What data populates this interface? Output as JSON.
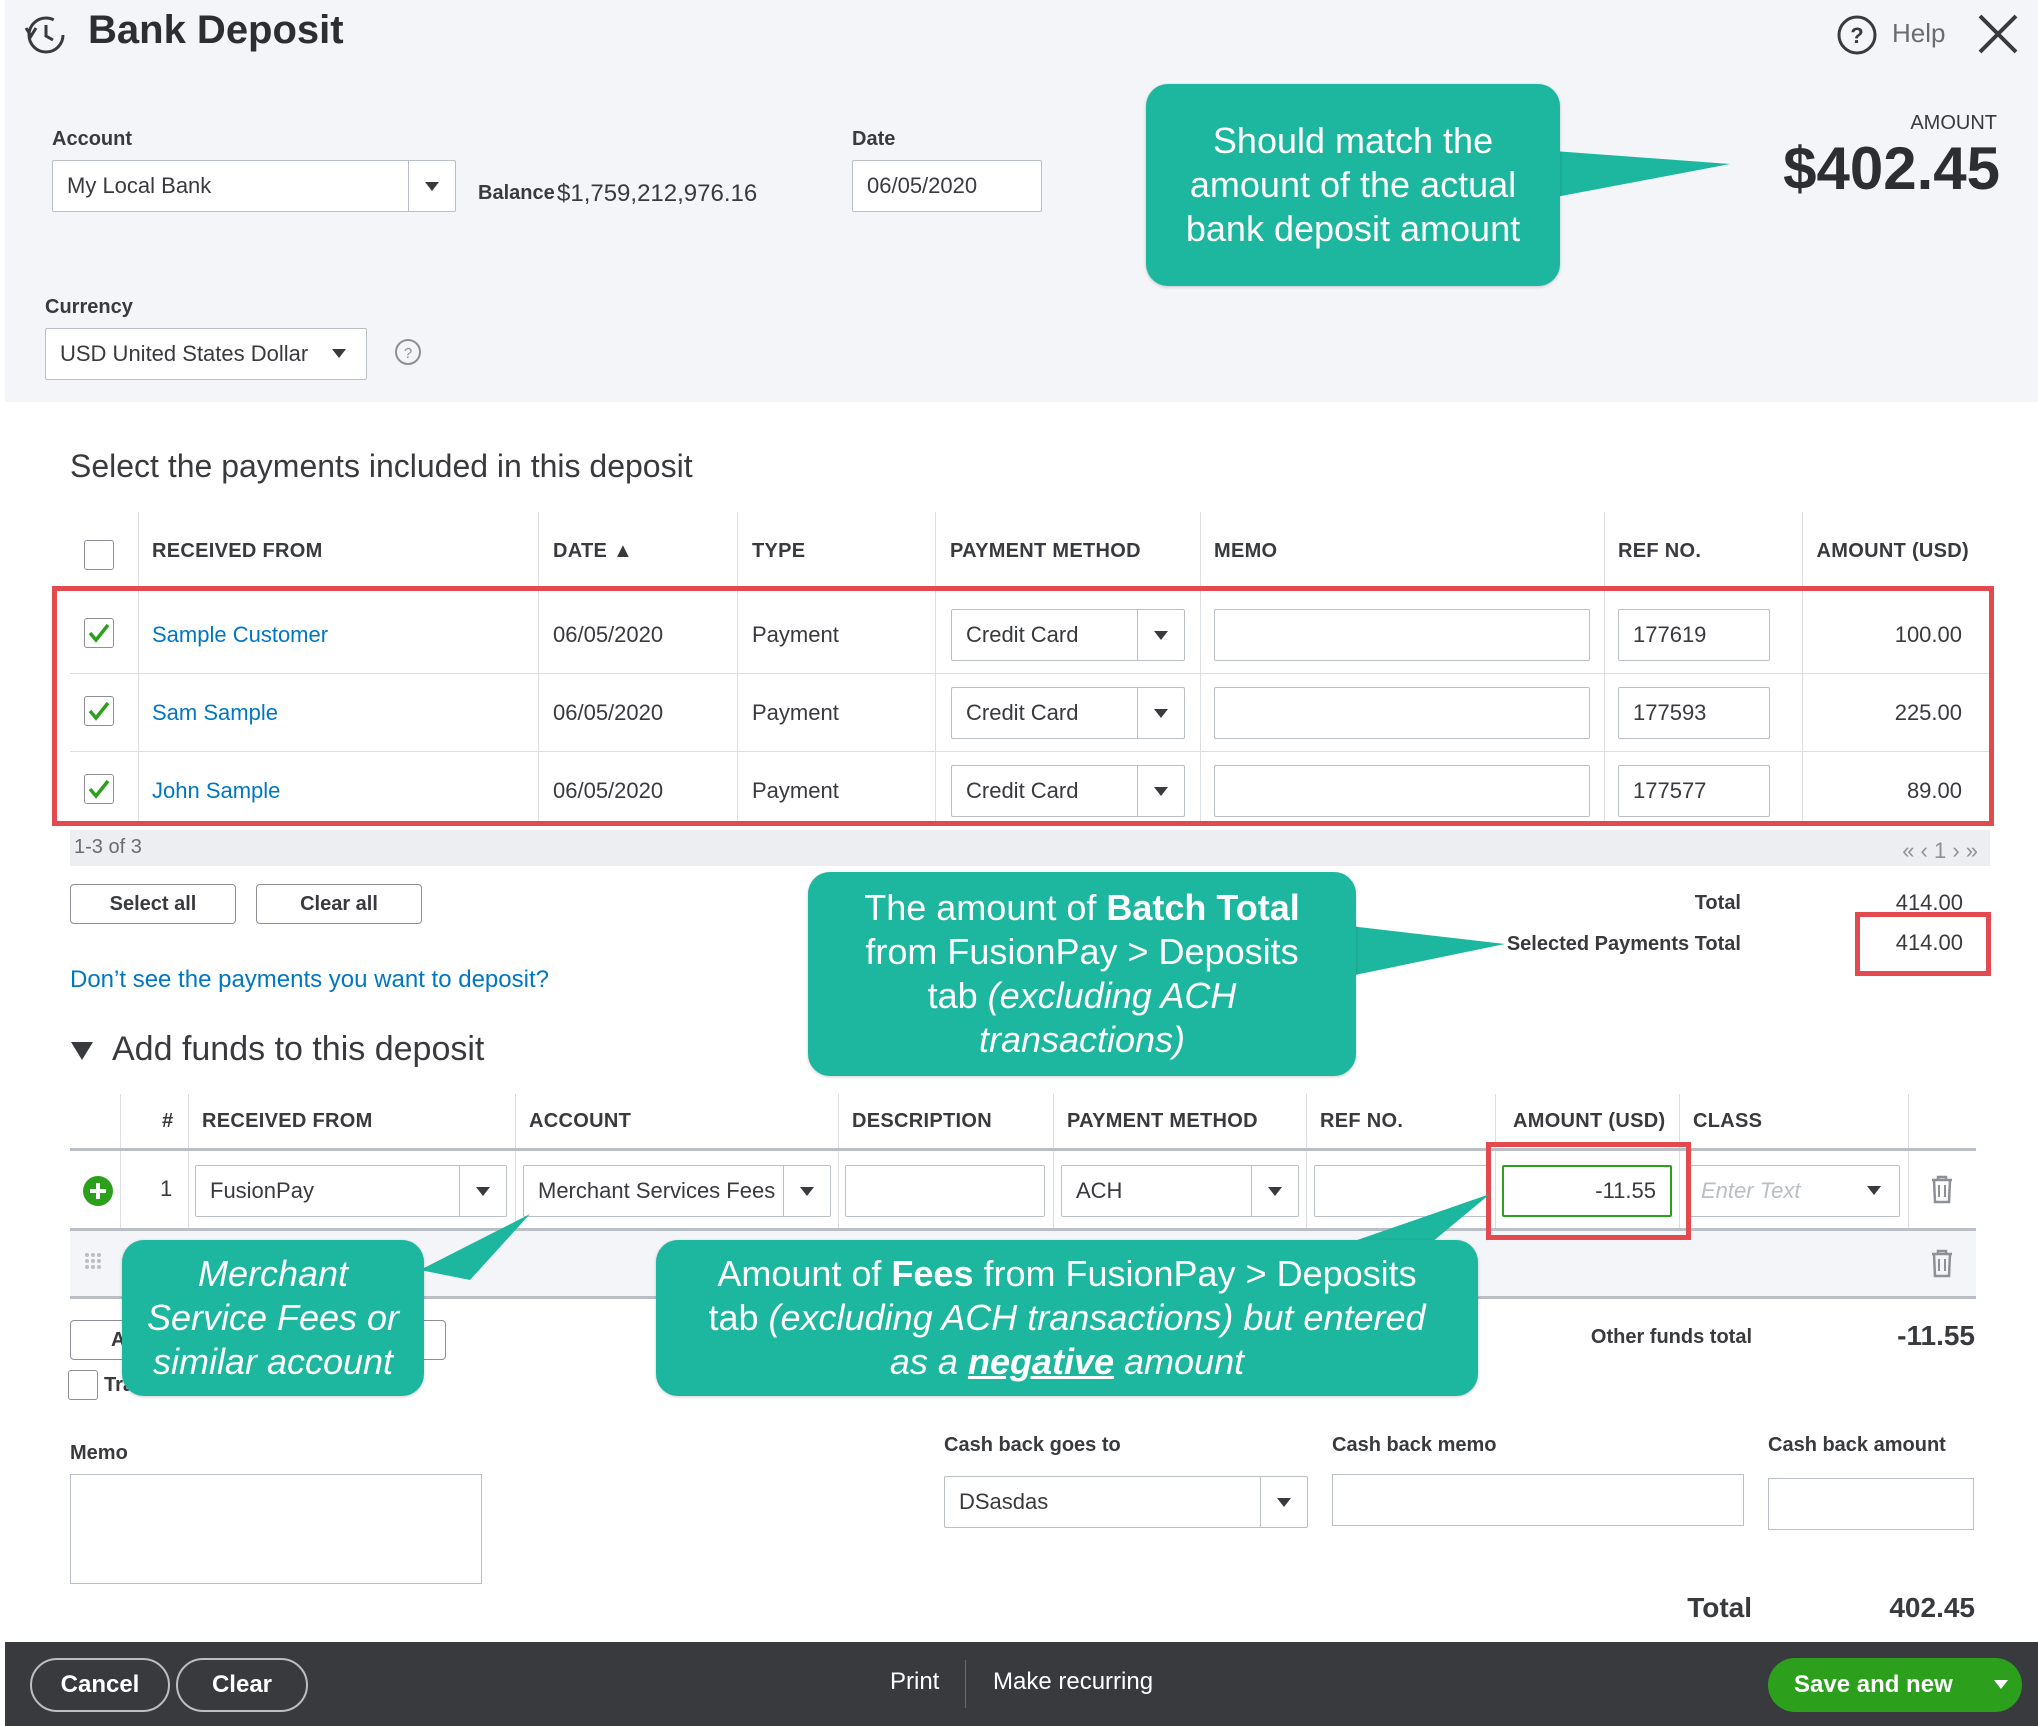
{
  "header": {
    "title": "Bank Deposit",
    "help_label": "Help",
    "account_label": "Account",
    "account_value": "My Local Bank",
    "balance_label": "Balance",
    "balance_value": "$1,759,212,976.16",
    "date_label": "Date",
    "date_value": "06/05/2020",
    "currency_label": "Currency",
    "currency_value": "USD United States Dollar",
    "amount_label": "AMOUNT",
    "amount_value": "$402.45"
  },
  "payments": {
    "heading": "Select the payments included in this deposit",
    "columns": [
      "RECEIVED FROM",
      "DATE ▲",
      "TYPE",
      "PAYMENT METHOD",
      "MEMO",
      "REF NO.",
      "AMOUNT (USD)"
    ],
    "rows": [
      {
        "received_from": "Sample Customer",
        "date": "06/05/2020",
        "type": "Payment",
        "method": "Credit Card",
        "memo": "",
        "ref": "177619",
        "amount": "100.00"
      },
      {
        "received_from": "Sam Sample",
        "date": "06/05/2020",
        "type": "Payment",
        "method": "Credit Card",
        "memo": "",
        "ref": "177593",
        "amount": "225.00"
      },
      {
        "received_from": "John Sample",
        "date": "06/05/2020",
        "type": "Payment",
        "method": "Credit Card",
        "memo": "",
        "ref": "177577",
        "amount": "89.00"
      }
    ],
    "range_text": "1-3 of 3",
    "pager": "« ‹ 1 › »",
    "select_all": "Select all",
    "clear_all": "Clear all",
    "total_label": "Total",
    "total_value": "414.00",
    "selected_total_label": "Selected Payments Total",
    "selected_total_value": "414.00",
    "missing_link": "Don’t see the payments you want to deposit?"
  },
  "funds": {
    "heading": "Add funds to this deposit",
    "columns": [
      "#",
      "RECEIVED FROM",
      "ACCOUNT",
      "DESCRIPTION",
      "PAYMENT METHOD",
      "REF NO.",
      "AMOUNT (USD)",
      "CLASS"
    ],
    "row": {
      "num": "1",
      "received_from": "FusionPay",
      "account": "Merchant Services Fees",
      "description": "",
      "method": "ACH",
      "ref": "",
      "amount": "-11.55",
      "class_placeholder": "Enter Text"
    },
    "add_lines_fragment": "A",
    "track_fragment": "Tra",
    "other_funds_label": "Other funds total",
    "other_funds_value": "-11.55"
  },
  "bottom": {
    "memo_label": "Memo",
    "cash_back_to_label": "Cash back goes to",
    "cash_back_to_value": "DSasdas",
    "cash_back_memo_label": "Cash back memo",
    "cash_back_amount_label": "Cash back amount",
    "total_label": "Total",
    "total_value": "402.45"
  },
  "footer": {
    "cancel": "Cancel",
    "clear": "Clear",
    "print": "Print",
    "make_recurring": "Make recurring",
    "save_new": "Save and new"
  },
  "callouts": {
    "amount": [
      "Should match the",
      "amount of the actual",
      "bank deposit amount"
    ],
    "batch": {
      "line1_pre": "The amount of ",
      "line1_bold": "Batch Total",
      "line2": "from FusionPay > Deposits",
      "line3_pre": "tab ",
      "line3_italic": "(excluding ACH",
      "line4_italic": "transactions)"
    },
    "merchant": [
      "Merchant",
      "Service Fees or",
      "similar account"
    ],
    "fees": {
      "line1_pre": "Amount of ",
      "line1_bold": "Fees",
      "line1_post": " from FusionPay > Deposits",
      "line2_pre": "tab ",
      "line2_italic": "(excluding ACH transactions) but entered",
      "line3_pre": "as a ",
      "line3_bold": "negative",
      "line3_post": " amount"
    }
  },
  "colors": {
    "accent_green": "#2ca01c",
    "callout_teal": "#1db69f",
    "highlight_red": "#e34a4f",
    "link_blue": "#0077c5"
  },
  "icons": [
    "recent-history-icon",
    "help-circle-icon",
    "close-icon",
    "check-icon",
    "add-circle-icon",
    "trash-icon",
    "drag-handle-icon",
    "chevron-down-icon"
  ]
}
